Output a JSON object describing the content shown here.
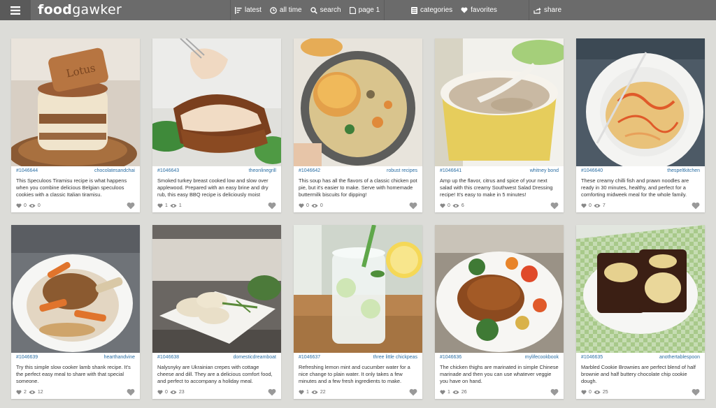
{
  "app": {
    "logo_bold": "food",
    "logo_light": "gawker",
    "menu_icon": "hamburger-menu-icon"
  },
  "nav": {
    "latest": "latest",
    "all_time": "all time",
    "search": "search",
    "page": "page 1",
    "categories": "categories",
    "favorites": "favorites",
    "share": "share"
  },
  "cards": [
    {
      "id": "#1046644",
      "source": "chocolatesandchai",
      "desc": "This Speculoos Tiramisu recipe is what happens when you combine delicious Belgian speculoos cookies with a classic Italian tiramisu.",
      "likes": "0",
      "views": "0",
      "image": "tiramisu-in-glass"
    },
    {
      "id": "#1046643",
      "source": "theonlinegrill",
      "desc": "Smoked turkey breast cooked low and slow over applewood. Prepared with an easy brine and dry rub, this easy BBQ recipe is deliciously moist",
      "likes": "1",
      "views": "1",
      "image": "sliced-smoked-turkey"
    },
    {
      "id": "#1046642",
      "source": "robust recipes",
      "desc": "This soup has all the flavors of a classic chicken pot pie, but it's easier to make. Serve with homemade buttermilk biscuits for dipping!",
      "likes": "0",
      "views": "0",
      "image": "chicken-pot-pie-soup"
    },
    {
      "id": "#1046641",
      "source": "whitney bond",
      "desc": "Amp up the flavor, citrus and spice of your next salad with this creamy Southwest Salad Dressing recipe! It's easy to make in 5 minutes!",
      "likes": "0",
      "views": "6",
      "image": "dressing-in-ramekin"
    },
    {
      "id": "#1046640",
      "source": "thespeltkitchen",
      "desc": "These creamy chilli fish and prawn noodles are ready in 30 minutes, healthy, and perfect for a comforting midweek meal for the whole family.",
      "likes": "0",
      "views": "7",
      "image": "noodles-on-plate"
    },
    {
      "id": "#1046639",
      "source": "hearthandvine",
      "desc": "Try this simple slow cooker lamb shank recipe. It's the perfect easy meal to share with that special someone.",
      "likes": "2",
      "views": "12",
      "image": "lamb-shank-carrots"
    },
    {
      "id": "#1046638",
      "source": "domesticdreamboat",
      "desc": "Nalysnyky are Ukrainian crepes with cottage cheese and dill. They are a delicious comfort food, and perfect to accompany a holiday meal.",
      "likes": "0",
      "views": "23",
      "image": "crepes-with-dill"
    },
    {
      "id": "#1046637",
      "source": "three little chickpeas",
      "desc": "Refreshing lemon mint and cucumber water for a nice change to plain water. It only takes a few minutes and a few fresh ingredients to make.",
      "likes": "1",
      "views": "22",
      "image": "cucumber-water-glass"
    },
    {
      "id": "#1046636",
      "source": "mylifecookbook",
      "desc": "The chicken thighs are marinated in simple Chinese marinade and then you can use whatever veggie you have on hand.",
      "likes": "1",
      "views": "26",
      "image": "chicken-thighs-veggies"
    },
    {
      "id": "#1046635",
      "source": "anothertablespoon",
      "desc": "Marbled Cookie Brownies are perfect blend of half brownie and half buttery chocolate chip cookie dough.",
      "likes": "0",
      "views": "25",
      "image": "marbled-brownies"
    }
  ],
  "colors": {
    "topbar": "#6b6b6b",
    "background": "#dcdcd8",
    "link": "#2b6ea3"
  }
}
